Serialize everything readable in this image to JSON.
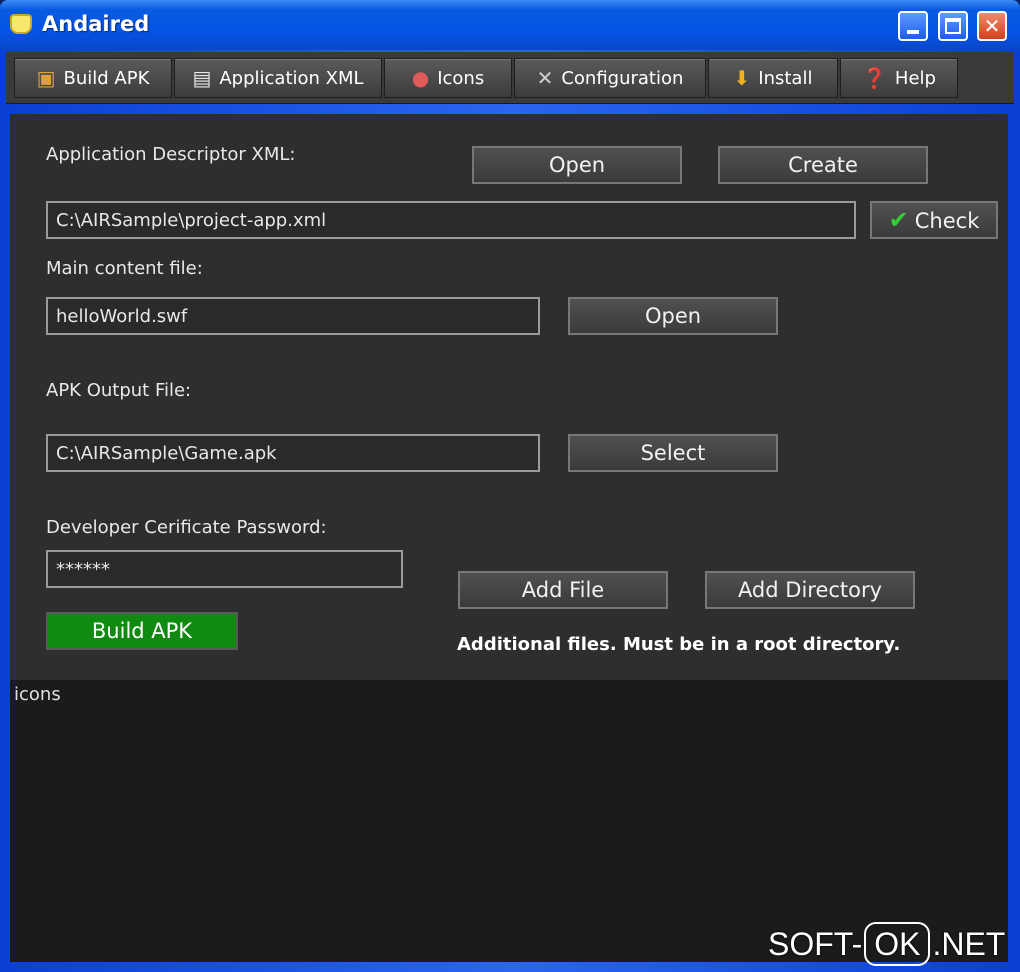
{
  "window": {
    "title": "Andaired"
  },
  "toolbar": {
    "build_apk": "Build APK",
    "application_xml": "Application XML",
    "icons": "Icons",
    "configuration": "Configuration",
    "install": "Install",
    "help": "Help"
  },
  "form": {
    "descriptor_label": "Application Descriptor XML:",
    "descriptor_open": "Open",
    "descriptor_create": "Create",
    "descriptor_value": "C:\\AIRSample\\project-app.xml",
    "check_label": "Check",
    "main_content_label": "Main content file:",
    "main_content_value": "helloWorld.swf",
    "main_content_open": "Open",
    "apk_output_label": "APK Output File:",
    "apk_output_value": "C:\\AIRSample\\Game.apk",
    "apk_output_select": "Select",
    "password_label": "Developer Cerificate Password:",
    "password_value": "******",
    "build_button": "Build APK",
    "add_file": "Add File",
    "add_directory": "Add Directory",
    "additional_note": "Additional files. Must be in a root directory."
  },
  "log": {
    "text": "icons"
  },
  "watermark": {
    "left": "SOFT-",
    "box": "OK",
    "right": ".NET"
  },
  "colors": {
    "accent_green": "#118a11",
    "titlebar_blue": "#0554e6"
  }
}
